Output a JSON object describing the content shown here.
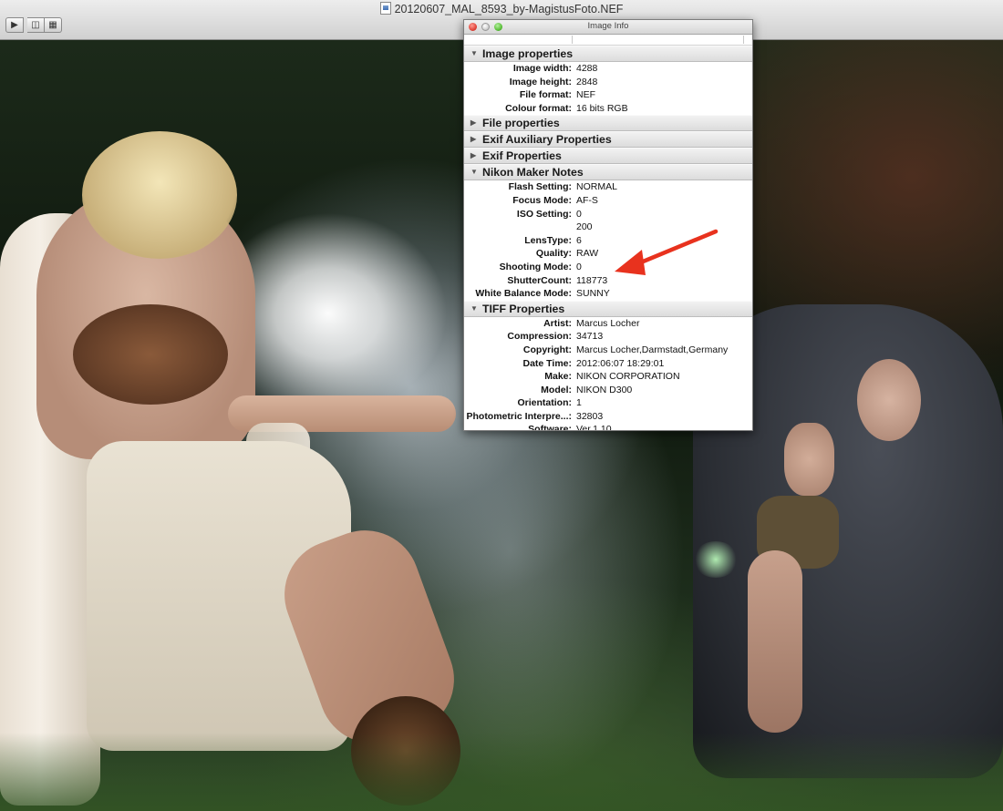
{
  "window": {
    "title": "20120607_MAL_8593_by-MagistusFoto.NEF"
  },
  "toolbar": {
    "buttons": [
      "play-icon",
      "split-view-icon",
      "grid-view-icon"
    ]
  },
  "info_panel": {
    "title": "Image Info",
    "sections": {
      "image_properties": {
        "label": "Image properties",
        "rows": [
          {
            "key": "Image width:",
            "value": "4288"
          },
          {
            "key": "Image height:",
            "value": "2848"
          },
          {
            "key": "File format:",
            "value": "NEF"
          },
          {
            "key": "Colour format:",
            "value": "16 bits RGB"
          }
        ]
      },
      "file_properties": {
        "label": "File properties"
      },
      "exif_auxiliary": {
        "label": "Exif Auxiliary Properties"
      },
      "exif_properties": {
        "label": "Exif Properties"
      },
      "nikon_maker_notes": {
        "label": "Nikon Maker Notes",
        "rows": [
          {
            "key": "Flash Setting:",
            "value": "NORMAL"
          },
          {
            "key": "Focus Mode:",
            "value": "AF-S"
          },
          {
            "key": "ISO Setting:",
            "value": "0"
          },
          {
            "key": "",
            "value": "200"
          },
          {
            "key": "LensType:",
            "value": "6"
          },
          {
            "key": "Quality:",
            "value": "RAW"
          },
          {
            "key": "Shooting Mode:",
            "value": "0"
          },
          {
            "key": "ShutterCount:",
            "value": "118773"
          },
          {
            "key": "White Balance Mode:",
            "value": "SUNNY"
          }
        ]
      },
      "tiff_properties": {
        "label": "TIFF Properties",
        "rows": [
          {
            "key": "Artist:",
            "value": "Marcus Locher"
          },
          {
            "key": "Compression:",
            "value": "34713"
          },
          {
            "key": "Copyright:",
            "value": "Marcus Locher,Darmstadt,Germany"
          },
          {
            "key": "Date Time:",
            "value": "2012:06:07 18:29:01"
          },
          {
            "key": "Make:",
            "value": "NIKON CORPORATION"
          },
          {
            "key": "Model:",
            "value": "NIKON D300"
          },
          {
            "key": "Orientation:",
            "value": "1"
          },
          {
            "key": "Photometric Interpre...:",
            "value": "32803"
          },
          {
            "key": "Software:",
            "value": "Ver.1.10"
          }
        ]
      }
    }
  },
  "colors": {
    "annotation_arrow": "#e8321e"
  }
}
